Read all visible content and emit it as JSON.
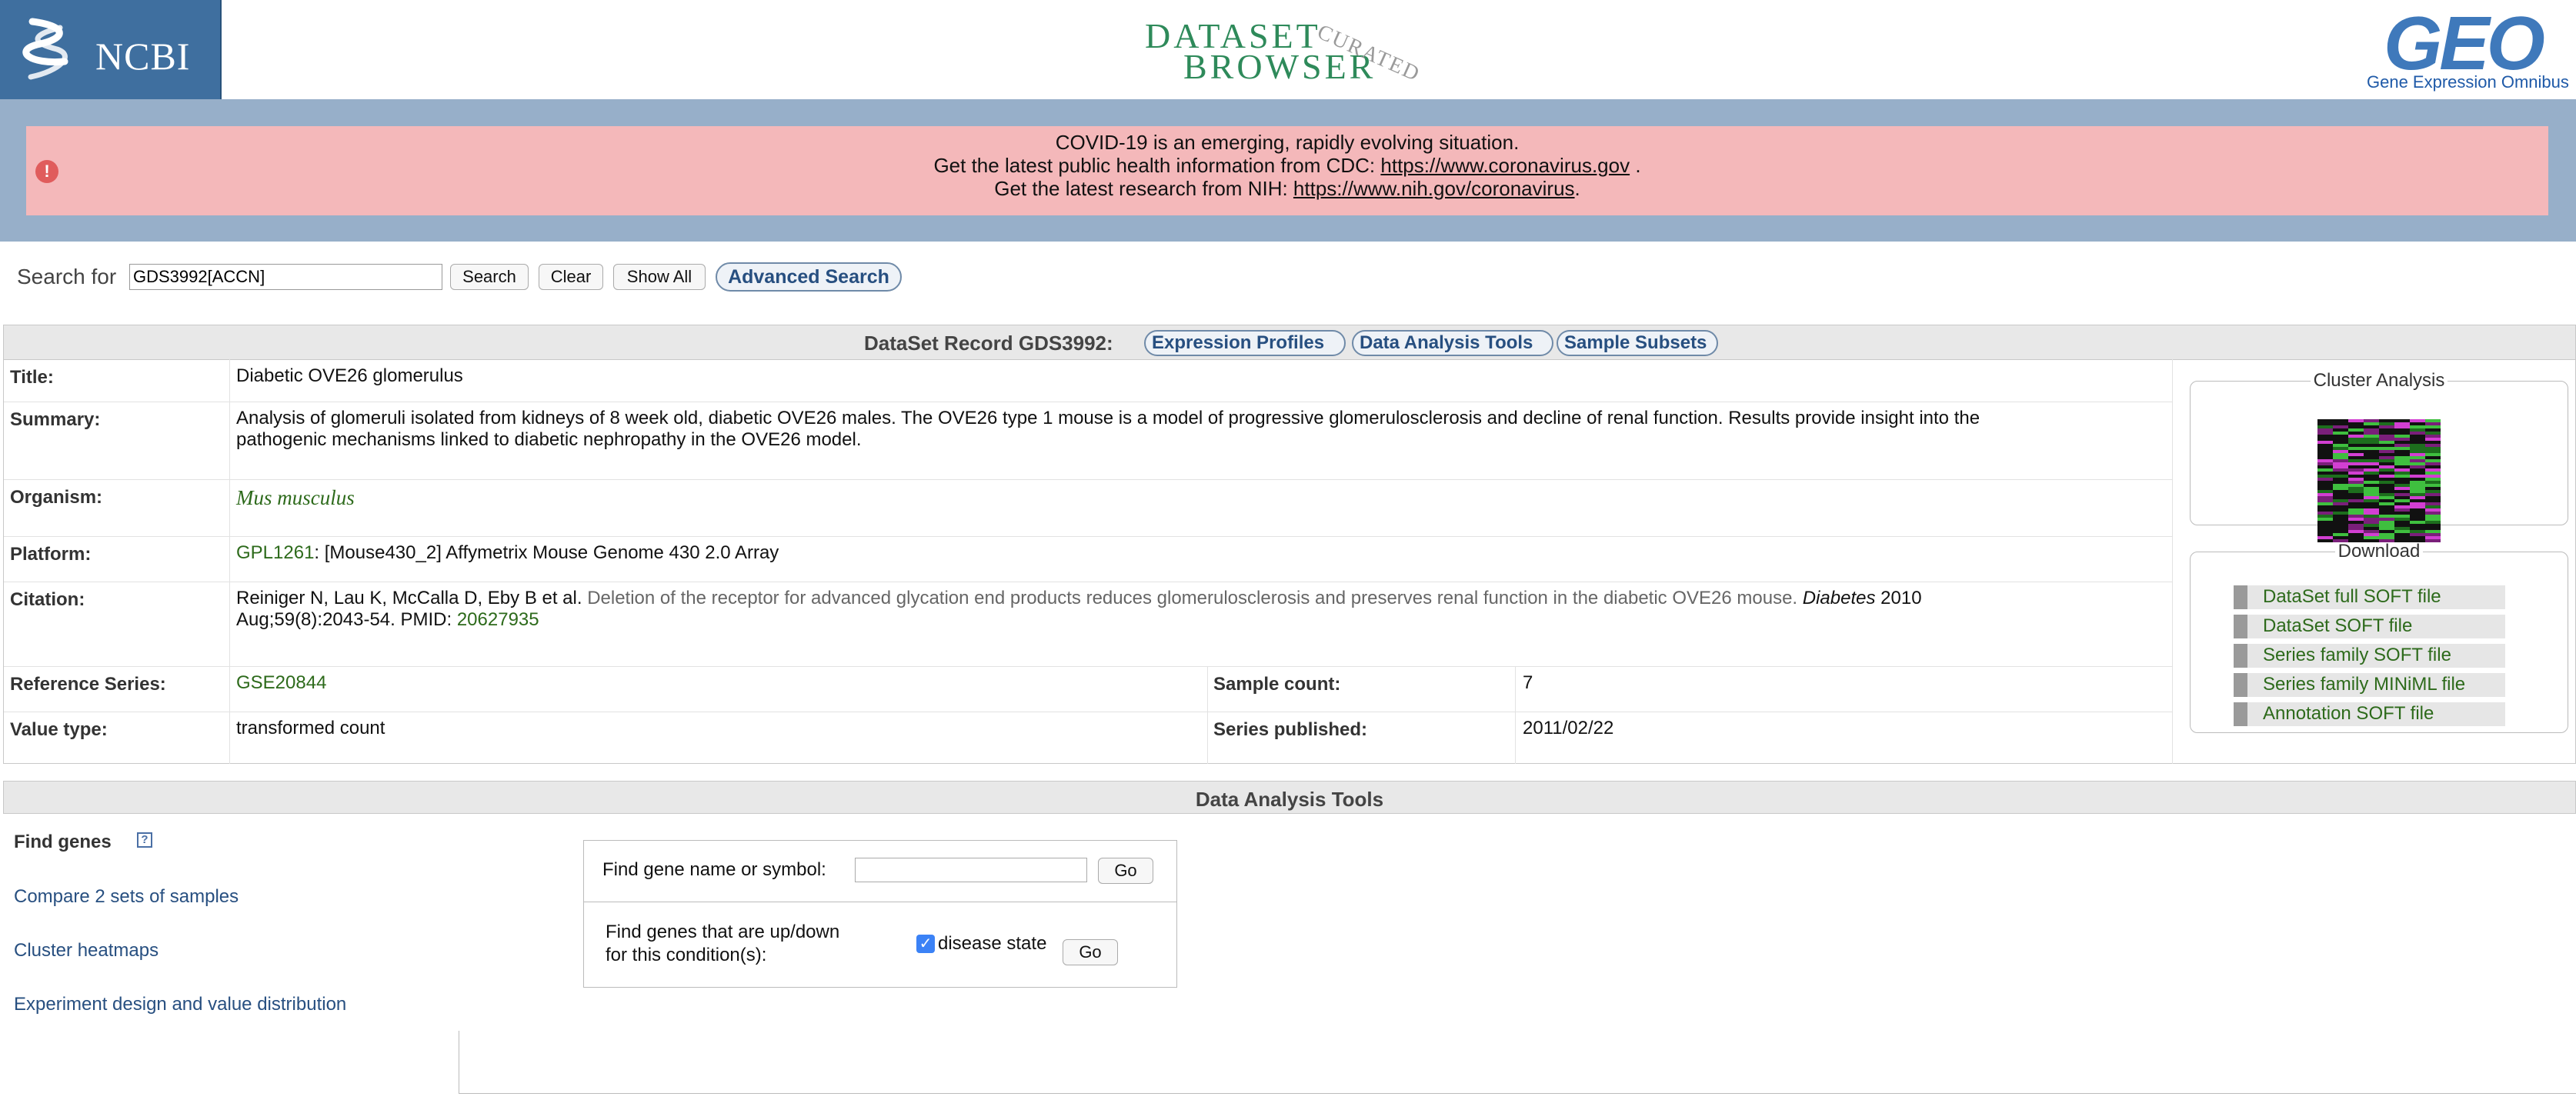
{
  "header": {
    "ncbi_logo_text": "NCBI",
    "dsb_word1": "DATASET",
    "dsb_word2": "BROWSER",
    "dsb_curated": "CURATED",
    "geo_word": "GEO",
    "geo_subtitle": "Gene Expression Omnibus"
  },
  "alert": {
    "line1": "COVID-19 is an emerging, rapidly evolving situation.",
    "line2_prefix": "Get the latest public health information from CDC: ",
    "line2_link": "https://www.coronavirus.gov",
    "line2_suffix": " .",
    "line3_prefix": "Get the latest research from NIH: ",
    "line3_link": "https://www.nih.gov/coronavirus",
    "line3_suffix": ".",
    "icon": "alert-exclamation-icon",
    "color_background": "#f4b8ba",
    "color_band": "#97afc9"
  },
  "search": {
    "label": "Search for",
    "value": "GDS3992[ACCN]",
    "search_button": "Search",
    "clear_button": "Clear",
    "show_all_button": "Show All",
    "advanced_button": "Advanced Search"
  },
  "record": {
    "heading": "DataSet Record GDS3992:",
    "tabs": [
      "Expression Profiles",
      "Data Analysis Tools",
      "Sample Subsets"
    ],
    "title_label": "Title:",
    "title_value": "Diabetic OVE26 glomerulus",
    "summary_label": "Summary:",
    "summary_line1": "Analysis of glomeruli isolated from kidneys of 8 week old, diabetic OVE26 males. The OVE26 type 1 mouse is a model of progressive glomerulosclerosis and decline of renal function. Results provide insight into the",
    "summary_line2": "pathogenic mechanisms linked to diabetic nephropathy in the OVE26 model.",
    "organism_label": "Organism:",
    "organism_value": "Mus musculus",
    "platform_label": "Platform:",
    "platform_link": "GPL1261",
    "platform_rest": ": [Mouse430_2] Affymetrix Mouse Genome 430 2.0 Array",
    "citation_label": "Citation:",
    "citation_authors": "Reiniger N, Lau K, McCalla D, Eby B et al. ",
    "citation_title": "Deletion of the receptor for advanced glycation end products reduces glomerulosclerosis and preserves renal function in the diabetic OVE26 mouse. ",
    "citation_journal": "Diabetes",
    "citation_year": " 2010",
    "citation_line2": "Aug;59(8):2043-54. PMID: ",
    "citation_pmid": "20627935",
    "refseries_label": "Reference Series:",
    "refseries_value": "GSE20844",
    "samplecount_label": "Sample count:",
    "samplecount_value": "7",
    "valuetype_label": "Value type:",
    "valuetype_value": "transformed count",
    "published_label": "Series published:",
    "published_value": "2011/02/22"
  },
  "right_panel": {
    "cluster_title": "Cluster Analysis",
    "download_title": "Download",
    "downloads": [
      "DataSet full SOFT file",
      "DataSet SOFT file",
      "Series family SOFT file",
      "Series family MINiML file",
      "Annotation SOFT file"
    ]
  },
  "tools": {
    "heading": "Data Analysis Tools",
    "find_genes": "Find genes",
    "help_icon_text": "?",
    "compare": "Compare 2 sets of samples",
    "cluster_heatmaps": "Cluster heatmaps",
    "experiment_design": "Experiment design and value distribution",
    "find_gene_label": "Find gene name or symbol:",
    "go1": "Go",
    "updown_line1": "Find genes that are up/down",
    "updown_line2": "for this condition(s):",
    "checkbox_label": "disease state",
    "checkbox_checked": true,
    "go2": "Go"
  }
}
